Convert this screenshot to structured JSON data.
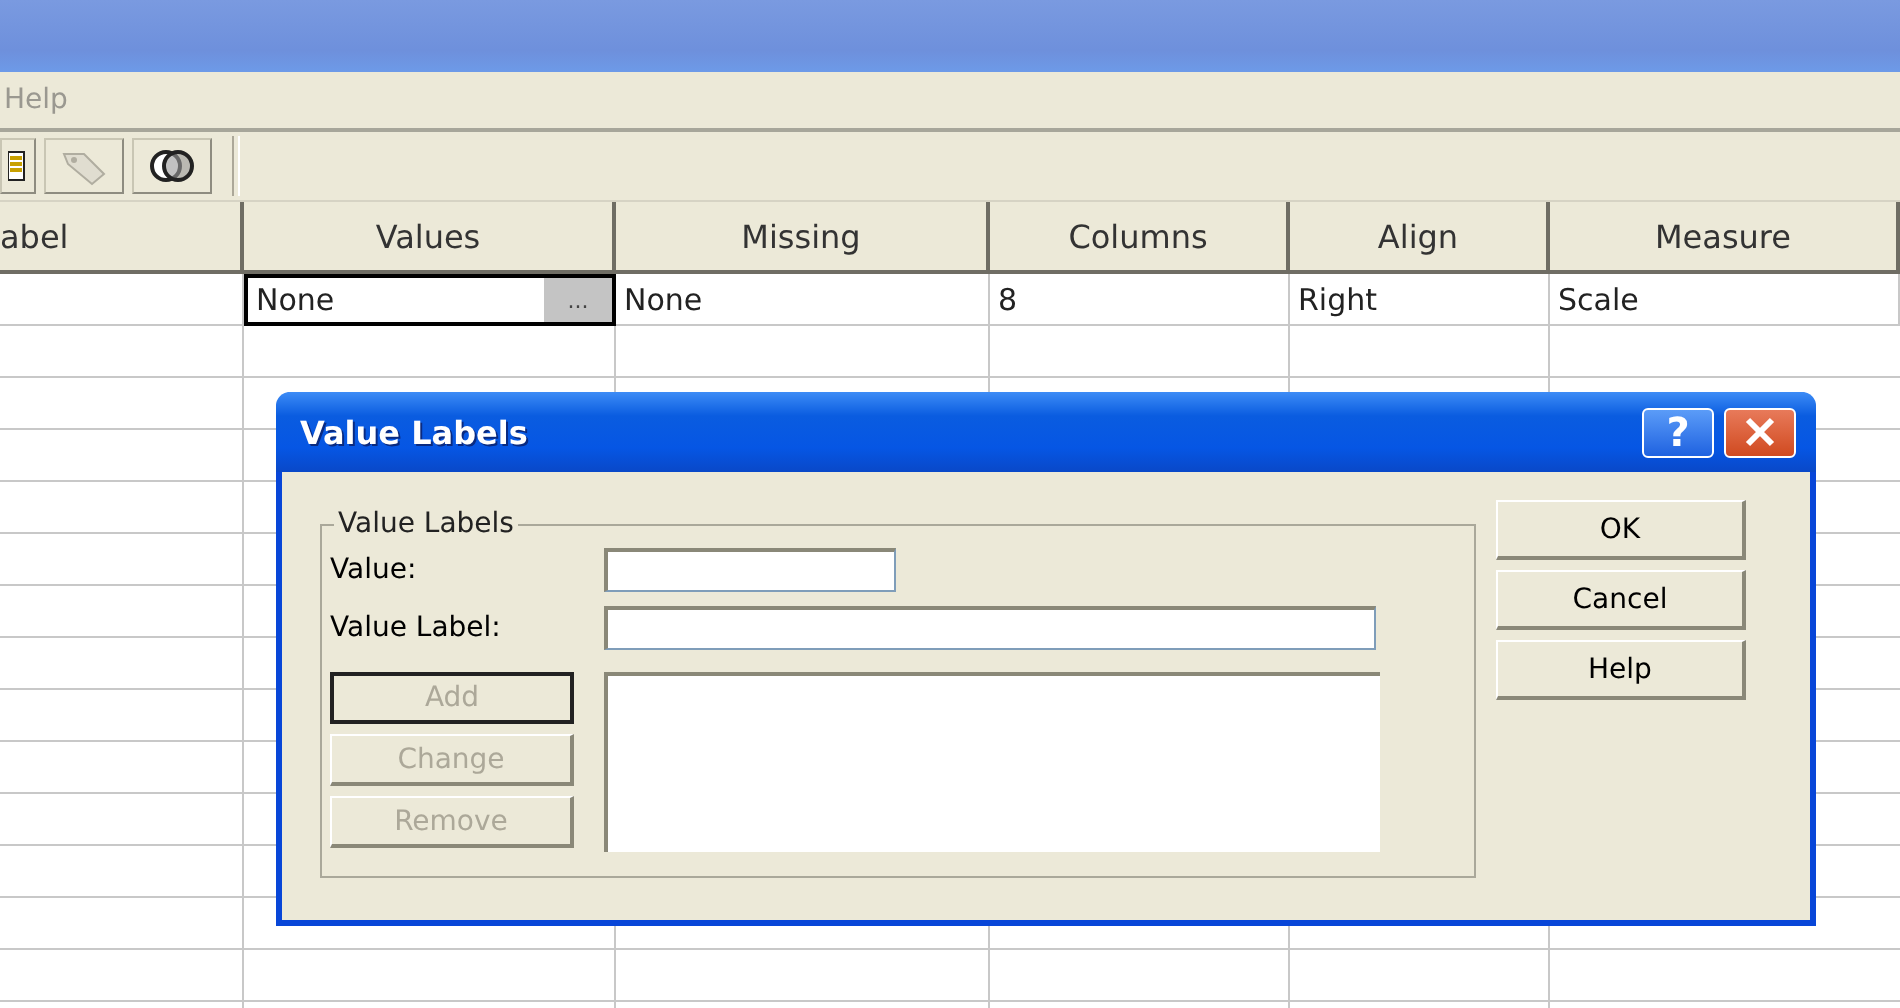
{
  "menu_bar": {
    "items": [
      "Help"
    ]
  },
  "grid": {
    "columns": [
      "abel",
      "Values",
      "Missing",
      "Columns",
      "Align",
      "Measure"
    ],
    "rows": [
      [
        {
          "text": "",
          "selected": false
        },
        {
          "text": "None",
          "selected": true,
          "ellipsis": "..."
        },
        {
          "text": "None",
          "selected": false
        },
        {
          "text": "8",
          "selected": false
        },
        {
          "text": "Right",
          "selected": false
        },
        {
          "text": "Scale",
          "selected": false
        }
      ]
    ]
  },
  "dialog": {
    "title": "Value Labels",
    "help_glyph": "?",
    "group_title": "Value Labels",
    "fields": [
      {
        "label": "Value:",
        "kind": "short"
      },
      {
        "label": "Value Label:",
        "kind": "long"
      }
    ],
    "list_buttons": [
      {
        "label": "Add",
        "disabled": true,
        "default": true
      },
      {
        "label": "Change",
        "disabled": true,
        "default": false
      },
      {
        "label": "Remove",
        "disabled": true,
        "default": false
      }
    ],
    "buttons": [
      {
        "label": "OK",
        "disabled": false
      },
      {
        "label": "Cancel",
        "disabled": false
      },
      {
        "label": "Help",
        "disabled": false
      }
    ]
  }
}
